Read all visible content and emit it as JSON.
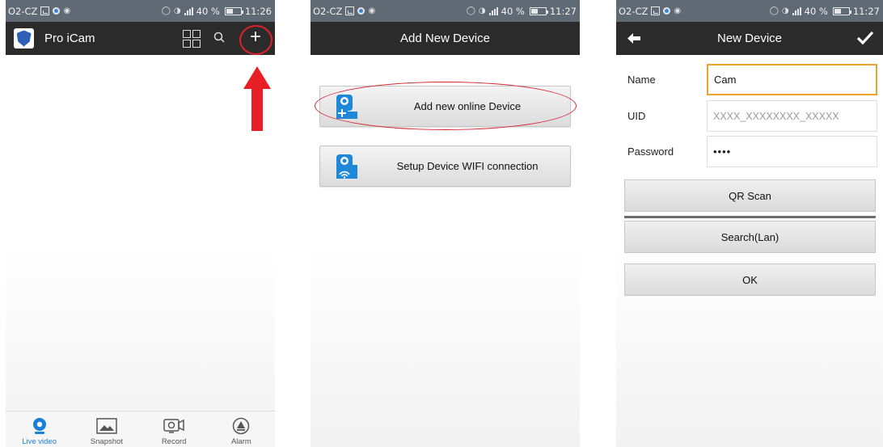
{
  "status_bars": [
    {
      "carrier": "O2-CZ",
      "battery": "40 %",
      "time": "11:26"
    },
    {
      "carrier": "O2-CZ",
      "battery": "40 %",
      "time": "11:27"
    },
    {
      "carrier": "O2-CZ",
      "battery": "40 %",
      "time": "11:27"
    }
  ],
  "screen1": {
    "app_name": "Pro iCam",
    "nav": [
      {
        "label": "Live video",
        "icon": "live-video-icon",
        "active": true
      },
      {
        "label": "Snapshot",
        "icon": "snapshot-icon",
        "active": false
      },
      {
        "label": "Record",
        "icon": "record-icon",
        "active": false
      },
      {
        "label": "Alarm",
        "icon": "alarm-icon",
        "active": false
      }
    ]
  },
  "screen2": {
    "title": "Add New Device",
    "buttons": [
      {
        "label": "Add new online Device",
        "icon": "add-camera-icon"
      },
      {
        "label": "Setup Device WIFI connection",
        "icon": "wifi-camera-icon"
      }
    ]
  },
  "screen3": {
    "title": "New Device",
    "name_label": "Name",
    "name_value": "Cam",
    "uid_label": "UID",
    "uid_placeholder": "XXXX_XXXXXXXX_XXXXX",
    "password_label": "Password",
    "password_value": "••••",
    "qr_label": "QR Scan",
    "search_label": "Search(Lan)",
    "ok_label": "OK"
  },
  "colors": {
    "status_bar": "#606a74",
    "app_bar": "#2b2b2b",
    "accent_blue": "#1a7fd8",
    "annotation_red": "#e0202a",
    "focus_orange": "#f0a030"
  }
}
